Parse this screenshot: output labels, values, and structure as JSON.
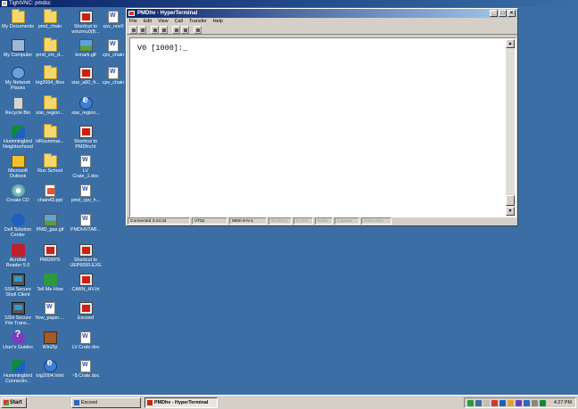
{
  "vnc": {
    "title": "TightVNC: pmdsc"
  },
  "desktop": {
    "icons": [
      {
        "label1": "My Documents",
        "label2": ""
      },
      {
        "label1": "pmd_chain",
        "label2": ""
      },
      {
        "label1": "Shortcut to",
        "label2": "winzmu0(B..."
      },
      {
        "label1": "cpv_nov0",
        "label2": ""
      },
      {
        "label1": "My Computer",
        "label2": ""
      },
      {
        "label1": "pmd_sm_d...",
        "label2": ""
      },
      {
        "label1": "konark.gif",
        "label2": ""
      },
      {
        "label1": "cpv_chain",
        "label2": ""
      },
      {
        "label1": "My Network",
        "label2": "Places"
      },
      {
        "label1": "trig2004_files",
        "label2": ""
      },
      {
        "label1": "star_a60_fr...",
        "label2": ""
      },
      {
        "label1": "cpv_chain",
        "label2": ""
      },
      {
        "label1": "Recycle Bin",
        "label2": ""
      },
      {
        "label1": "star_region...",
        "label2": ""
      },
      {
        "label1": "star_region...",
        "label2": ""
      },
      {
        "label1": "Hummingbird",
        "label2": "Neighborhood"
      },
      {
        "label1": "HRsummar...",
        "label2": ""
      },
      {
        "label1": "Shortcut to",
        "label2": "PMDhv.ht"
      },
      {
        "label1": "Microsoft",
        "label2": "Outlook"
      },
      {
        "label1": "Run School",
        "label2": ""
      },
      {
        "label1": "LV",
        "label2": "Crate_1.doc"
      },
      {
        "label1": "Create CD",
        "label2": ""
      },
      {
        "label1": "chain43.ppt",
        "label2": ""
      },
      {
        "label1": "pmd_cpv_h...",
        "label2": ""
      },
      {
        "label1": "Dell Solution",
        "label2": "Center"
      },
      {
        "label1": "PMD_gas.gif",
        "label2": ""
      },
      {
        "label1": "PMDHVTAB...",
        "label2": ""
      },
      {
        "label1": "Acrobat",
        "label2": "Reader 5.0"
      },
      {
        "label1": "PMDRPS",
        "label2": ""
      },
      {
        "label1": "Shortcut to",
        "label2": "UEP6000.EXE"
      },
      {
        "label1": "SSH Secure",
        "label2": "Shell Client"
      },
      {
        "label1": "Tell Me How",
        "label2": ""
      },
      {
        "label1": "CABN_HV.ht",
        "label2": ""
      },
      {
        "label1": "SSH Secure",
        "label2": "File Trans..."
      },
      {
        "label1": "flow_paper....",
        "label2": ""
      },
      {
        "label1": "Exceed",
        "label2": ""
      },
      {
        "label1": "User's Guides",
        "label2": ""
      },
      {
        "label1": "WinZip",
        "label2": ""
      },
      {
        "label1": "LV Crate.doc",
        "label2": ""
      },
      {
        "label1": "Hummingbird",
        "label2": "Connectiv..."
      },
      {
        "label1": "trig2004.html",
        "label2": ""
      },
      {
        "label1": "~$ Crate.doc",
        "label2": ""
      }
    ]
  },
  "window": {
    "title": "PMDhv - HyperTerminal",
    "menu": [
      "File",
      "Edit",
      "View",
      "Call",
      "Transfer",
      "Help"
    ],
    "terminal_text": "V0 [1000]:_",
    "status": [
      "Connected 3:44:34",
      "VT52",
      "9600 8-N-1",
      "SCROLL",
      "CAPS",
      "NUM",
      "Capture",
      "Print echo"
    ]
  },
  "taskbar": {
    "start_label": "Start",
    "tasks": [
      "Exceed",
      "PMDhv - HyperTerminal"
    ],
    "clock": "4:27 PM"
  }
}
